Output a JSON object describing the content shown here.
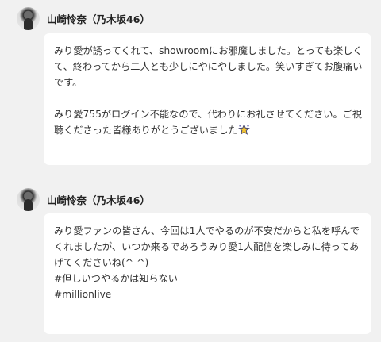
{
  "posts": [
    {
      "author": "山崎怜奈（乃木坂46）",
      "lines": [
        "みり愛が誘ってくれて、showroomにお邪魔しました。とっても楽しく",
        "て、終わってから二人とも少しにやにやしました。笑いすぎてお腹痛い",
        "です。",
        "",
        "みり愛755がログイン不能なので、代わりにお礼させてください。ご視",
        "聴くださった皆様ありがとうございました"
      ],
      "emoji": "sparkle-star-icon"
    },
    {
      "author": "山崎怜奈（乃木坂46）",
      "lines": [
        "みり愛ファンの皆さん、今回は1人でやるのが不安だからと私を呼んで",
        "くれましたが、いつか来るであろうみり愛1人配信を楽しみに待ってあ",
        "げてくださいね(^-^)",
        "#但しいつやるかは知らない",
        "#millionlive"
      ]
    }
  ],
  "colors": {
    "background": "#f1f1f1",
    "bubble": "#ffffff",
    "text": "#333333",
    "author": "#222222"
  }
}
